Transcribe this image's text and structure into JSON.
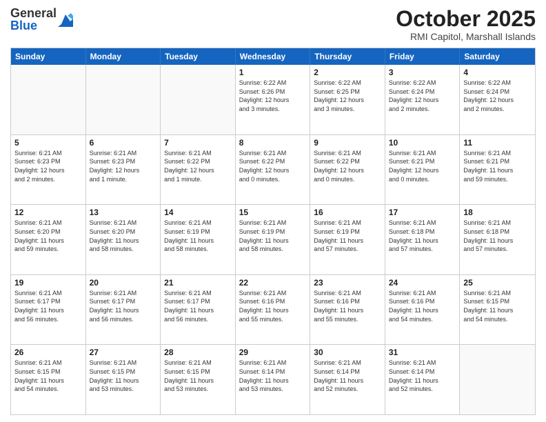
{
  "header": {
    "logo_general": "General",
    "logo_blue": "Blue",
    "month_title": "October 2025",
    "subtitle": "RMI Capitol, Marshall Islands"
  },
  "days_of_week": [
    "Sunday",
    "Monday",
    "Tuesday",
    "Wednesday",
    "Thursday",
    "Friday",
    "Saturday"
  ],
  "weeks": [
    [
      {
        "day": "",
        "empty": true
      },
      {
        "day": "",
        "empty": true
      },
      {
        "day": "",
        "empty": true
      },
      {
        "day": "1",
        "line1": "Sunrise: 6:22 AM",
        "line2": "Sunset: 6:26 PM",
        "line3": "Daylight: 12 hours",
        "line4": "and 3 minutes."
      },
      {
        "day": "2",
        "line1": "Sunrise: 6:22 AM",
        "line2": "Sunset: 6:25 PM",
        "line3": "Daylight: 12 hours",
        "line4": "and 3 minutes."
      },
      {
        "day": "3",
        "line1": "Sunrise: 6:22 AM",
        "line2": "Sunset: 6:24 PM",
        "line3": "Daylight: 12 hours",
        "line4": "and 2 minutes."
      },
      {
        "day": "4",
        "line1": "Sunrise: 6:22 AM",
        "line2": "Sunset: 6:24 PM",
        "line3": "Daylight: 12 hours",
        "line4": "and 2 minutes."
      }
    ],
    [
      {
        "day": "5",
        "line1": "Sunrise: 6:21 AM",
        "line2": "Sunset: 6:23 PM",
        "line3": "Daylight: 12 hours",
        "line4": "and 2 minutes."
      },
      {
        "day": "6",
        "line1": "Sunrise: 6:21 AM",
        "line2": "Sunset: 6:23 PM",
        "line3": "Daylight: 12 hours",
        "line4": "and 1 minute."
      },
      {
        "day": "7",
        "line1": "Sunrise: 6:21 AM",
        "line2": "Sunset: 6:22 PM",
        "line3": "Daylight: 12 hours",
        "line4": "and 1 minute."
      },
      {
        "day": "8",
        "line1": "Sunrise: 6:21 AM",
        "line2": "Sunset: 6:22 PM",
        "line3": "Daylight: 12 hours",
        "line4": "and 0 minutes."
      },
      {
        "day": "9",
        "line1": "Sunrise: 6:21 AM",
        "line2": "Sunset: 6:22 PM",
        "line3": "Daylight: 12 hours",
        "line4": "and 0 minutes."
      },
      {
        "day": "10",
        "line1": "Sunrise: 6:21 AM",
        "line2": "Sunset: 6:21 PM",
        "line3": "Daylight: 12 hours",
        "line4": "and 0 minutes."
      },
      {
        "day": "11",
        "line1": "Sunrise: 6:21 AM",
        "line2": "Sunset: 6:21 PM",
        "line3": "Daylight: 11 hours",
        "line4": "and 59 minutes."
      }
    ],
    [
      {
        "day": "12",
        "line1": "Sunrise: 6:21 AM",
        "line2": "Sunset: 6:20 PM",
        "line3": "Daylight: 11 hours",
        "line4": "and 59 minutes."
      },
      {
        "day": "13",
        "line1": "Sunrise: 6:21 AM",
        "line2": "Sunset: 6:20 PM",
        "line3": "Daylight: 11 hours",
        "line4": "and 58 minutes."
      },
      {
        "day": "14",
        "line1": "Sunrise: 6:21 AM",
        "line2": "Sunset: 6:19 PM",
        "line3": "Daylight: 11 hours",
        "line4": "and 58 minutes."
      },
      {
        "day": "15",
        "line1": "Sunrise: 6:21 AM",
        "line2": "Sunset: 6:19 PM",
        "line3": "Daylight: 11 hours",
        "line4": "and 58 minutes."
      },
      {
        "day": "16",
        "line1": "Sunrise: 6:21 AM",
        "line2": "Sunset: 6:19 PM",
        "line3": "Daylight: 11 hours",
        "line4": "and 57 minutes."
      },
      {
        "day": "17",
        "line1": "Sunrise: 6:21 AM",
        "line2": "Sunset: 6:18 PM",
        "line3": "Daylight: 11 hours",
        "line4": "and 57 minutes."
      },
      {
        "day": "18",
        "line1": "Sunrise: 6:21 AM",
        "line2": "Sunset: 6:18 PM",
        "line3": "Daylight: 11 hours",
        "line4": "and 57 minutes."
      }
    ],
    [
      {
        "day": "19",
        "line1": "Sunrise: 6:21 AM",
        "line2": "Sunset: 6:17 PM",
        "line3": "Daylight: 11 hours",
        "line4": "and 56 minutes."
      },
      {
        "day": "20",
        "line1": "Sunrise: 6:21 AM",
        "line2": "Sunset: 6:17 PM",
        "line3": "Daylight: 11 hours",
        "line4": "and 56 minutes."
      },
      {
        "day": "21",
        "line1": "Sunrise: 6:21 AM",
        "line2": "Sunset: 6:17 PM",
        "line3": "Daylight: 11 hours",
        "line4": "and 56 minutes."
      },
      {
        "day": "22",
        "line1": "Sunrise: 6:21 AM",
        "line2": "Sunset: 6:16 PM",
        "line3": "Daylight: 11 hours",
        "line4": "and 55 minutes."
      },
      {
        "day": "23",
        "line1": "Sunrise: 6:21 AM",
        "line2": "Sunset: 6:16 PM",
        "line3": "Daylight: 11 hours",
        "line4": "and 55 minutes."
      },
      {
        "day": "24",
        "line1": "Sunrise: 6:21 AM",
        "line2": "Sunset: 6:16 PM",
        "line3": "Daylight: 11 hours",
        "line4": "and 54 minutes."
      },
      {
        "day": "25",
        "line1": "Sunrise: 6:21 AM",
        "line2": "Sunset: 6:15 PM",
        "line3": "Daylight: 11 hours",
        "line4": "and 54 minutes."
      }
    ],
    [
      {
        "day": "26",
        "line1": "Sunrise: 6:21 AM",
        "line2": "Sunset: 6:15 PM",
        "line3": "Daylight: 11 hours",
        "line4": "and 54 minutes."
      },
      {
        "day": "27",
        "line1": "Sunrise: 6:21 AM",
        "line2": "Sunset: 6:15 PM",
        "line3": "Daylight: 11 hours",
        "line4": "and 53 minutes."
      },
      {
        "day": "28",
        "line1": "Sunrise: 6:21 AM",
        "line2": "Sunset: 6:15 PM",
        "line3": "Daylight: 11 hours",
        "line4": "and 53 minutes."
      },
      {
        "day": "29",
        "line1": "Sunrise: 6:21 AM",
        "line2": "Sunset: 6:14 PM",
        "line3": "Daylight: 11 hours",
        "line4": "and 53 minutes."
      },
      {
        "day": "30",
        "line1": "Sunrise: 6:21 AM",
        "line2": "Sunset: 6:14 PM",
        "line3": "Daylight: 11 hours",
        "line4": "and 52 minutes."
      },
      {
        "day": "31",
        "line1": "Sunrise: 6:21 AM",
        "line2": "Sunset: 6:14 PM",
        "line3": "Daylight: 11 hours",
        "line4": "and 52 minutes."
      },
      {
        "day": "",
        "empty": true
      }
    ]
  ]
}
